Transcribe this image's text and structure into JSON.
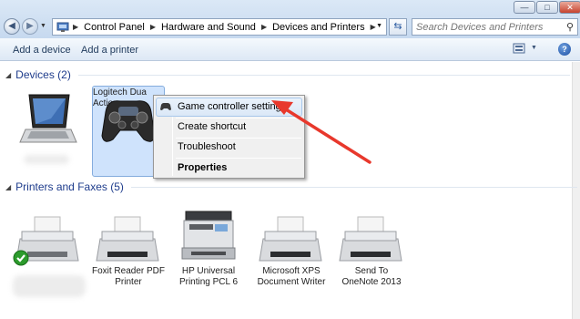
{
  "window": {
    "minimize": "—",
    "maximize": "□",
    "close": "✕"
  },
  "nav": {
    "back_icon": "back-arrow-icon",
    "forward_icon": "forward-arrow-icon"
  },
  "address": {
    "crumbs": [
      "Control Panel",
      "Hardware and Sound",
      "Devices and Printers"
    ]
  },
  "search": {
    "placeholder": "Search Devices and Printers"
  },
  "toolbar": {
    "add_device": "Add a device",
    "add_printer": "Add a printer"
  },
  "devices_group": {
    "title": "Devices (2)",
    "items": [
      {
        "name": ""
      },
      {
        "name_line1": "Logitech Dua",
        "name_line2": "Action"
      }
    ]
  },
  "printers_group": {
    "title": "Printers and Faxes (5)",
    "items": [
      {
        "line1": "",
        "line2": ""
      },
      {
        "line1": "Foxit Reader PDF",
        "line2": "Printer"
      },
      {
        "line1": "HP Universal",
        "line2": "Printing PCL 6"
      },
      {
        "line1": "Microsoft XPS",
        "line2": "Document Writer"
      },
      {
        "line1": "Send To",
        "line2": "OneNote 2013"
      }
    ]
  },
  "context_menu": {
    "items": [
      "Game controller settings",
      "Create shortcut",
      "Troubleshoot",
      "Properties"
    ]
  },
  "colors": {
    "accent_arrow": "#e8382c",
    "selection": "#cfe3fc",
    "group_title": "#1e3c8c"
  }
}
